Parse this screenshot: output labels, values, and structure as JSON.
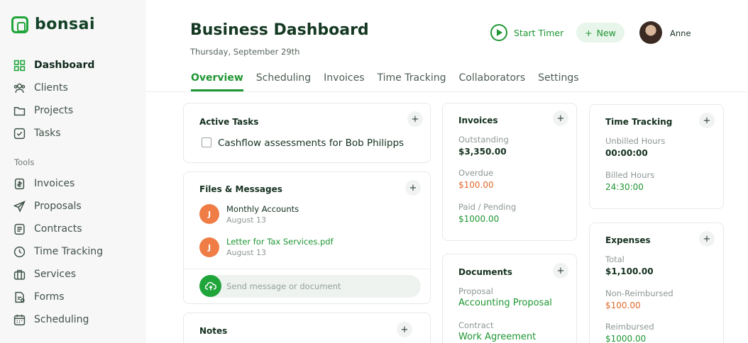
{
  "app": {
    "name": "bonsai"
  },
  "sidebar": {
    "items": [
      {
        "label": "Dashboard",
        "icon": "grid-icon"
      },
      {
        "label": "Clients",
        "icon": "users-icon"
      },
      {
        "label": "Projects",
        "icon": "folder-icon"
      },
      {
        "label": "Tasks",
        "icon": "checkbox-icon"
      }
    ],
    "tools_label": "Tools",
    "tools": [
      {
        "label": "Invoices",
        "icon": "invoice-icon"
      },
      {
        "label": "Proposals",
        "icon": "send-icon"
      },
      {
        "label": "Contracts",
        "icon": "document-icon"
      },
      {
        "label": "Time Tracking",
        "icon": "clock-icon"
      },
      {
        "label": "Services",
        "icon": "briefcase-icon"
      },
      {
        "label": "Forms",
        "icon": "form-icon"
      },
      {
        "label": "Scheduling",
        "icon": "calendar-icon"
      }
    ]
  },
  "header": {
    "title": "Business Dashboard",
    "date": "Thursday, September 29th",
    "start_timer": "Start Timer",
    "new_label": "New",
    "user_name": "Anne"
  },
  "tabs": [
    "Overview",
    "Scheduling",
    "Invoices",
    "Time Tracking",
    "Collaborators",
    "Settings"
  ],
  "active_tasks": {
    "title": "Active Tasks",
    "tasks": [
      "Cashflow assessments for Bob Philipps"
    ]
  },
  "files_messages": {
    "title": "Files & Messages",
    "items": [
      {
        "initial": "J",
        "title": "Monthly Accounts",
        "date": "August 13"
      },
      {
        "initial": "J",
        "title": "Letter for Tax Services.pdf",
        "date": "August 13"
      }
    ],
    "placeholder": "Send message or document"
  },
  "notes": {
    "title": "Notes"
  },
  "invoices": {
    "title": "Invoices",
    "rows": [
      {
        "label": "Outstanding",
        "value": "$3,350.00"
      },
      {
        "label": "Overdue",
        "value": "$100.00"
      },
      {
        "label": "Paid / Pending",
        "value": "$1000.00"
      }
    ]
  },
  "documents": {
    "title": "Documents",
    "rows": [
      {
        "label": "Proposal",
        "value": "Accounting Proposal"
      },
      {
        "label": "Contract",
        "value": "Work Agreement"
      }
    ]
  },
  "time_tracking": {
    "title": "Time Tracking",
    "rows": [
      {
        "label": "Unbilled Hours",
        "value": "00:00:00"
      },
      {
        "label": "Billed Hours",
        "value": "24:30:00"
      }
    ]
  },
  "expenses": {
    "title": "Expenses",
    "rows": [
      {
        "label": "Total",
        "value": "$1,100.00"
      },
      {
        "label": "Non-Reimbursed",
        "value": "$100.00"
      },
      {
        "label": "Reimbursed",
        "value": "$1000.00"
      }
    ]
  },
  "colors": {
    "accent": "#1fa53a",
    "warning": "#e06a2c",
    "text": "#143822"
  }
}
